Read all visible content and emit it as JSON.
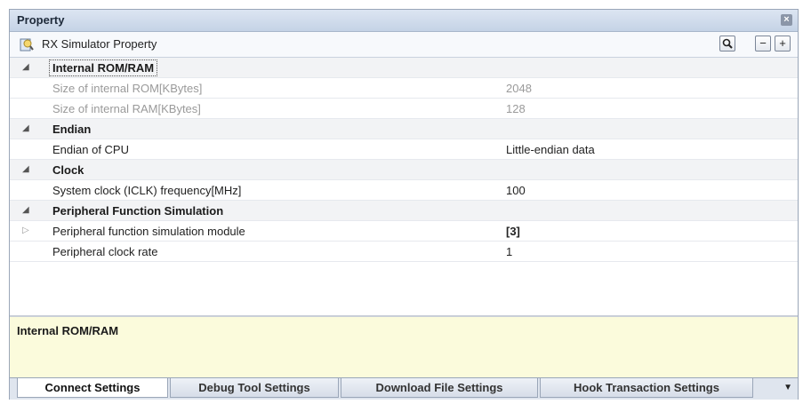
{
  "panel": {
    "title": "Property"
  },
  "toolbar": {
    "title": "RX Simulator Property",
    "minus": "−",
    "plus": "+"
  },
  "grid": {
    "rows": [
      {
        "type": "category",
        "label": "Internal ROM/RAM",
        "expanded": true
      },
      {
        "type": "property",
        "name": "Size of internal ROM[KBytes]",
        "value": "2048",
        "disabled": true
      },
      {
        "type": "property",
        "name": "Size of internal RAM[KBytes]",
        "value": "128",
        "disabled": true
      },
      {
        "type": "category",
        "label": "Endian",
        "expanded": true
      },
      {
        "type": "property",
        "name": "Endian of CPU",
        "value": "Little-endian data"
      },
      {
        "type": "category",
        "label": "Clock",
        "expanded": true
      },
      {
        "type": "property",
        "name": "System clock (ICLK) frequency[MHz]",
        "value": "100"
      },
      {
        "type": "category",
        "label": "Peripheral Function Simulation",
        "expanded": true
      },
      {
        "type": "property",
        "name": "Peripheral function simulation module",
        "value": "[3]",
        "expandable": true
      },
      {
        "type": "property",
        "name": "Peripheral clock rate",
        "value": "1"
      }
    ]
  },
  "description": {
    "text": "Internal ROM/RAM"
  },
  "tabs": [
    {
      "label": "Connect Settings",
      "active": true
    },
    {
      "label": "Debug Tool Settings"
    },
    {
      "label": "Download File Settings"
    },
    {
      "label": "Hook Transaction Settings"
    }
  ],
  "icons": {
    "property_icon": "property-icon",
    "search_icon": "magnifier-icon",
    "close_icon": "close-icon",
    "tab_menu_icon": "chevron-down-icon"
  }
}
